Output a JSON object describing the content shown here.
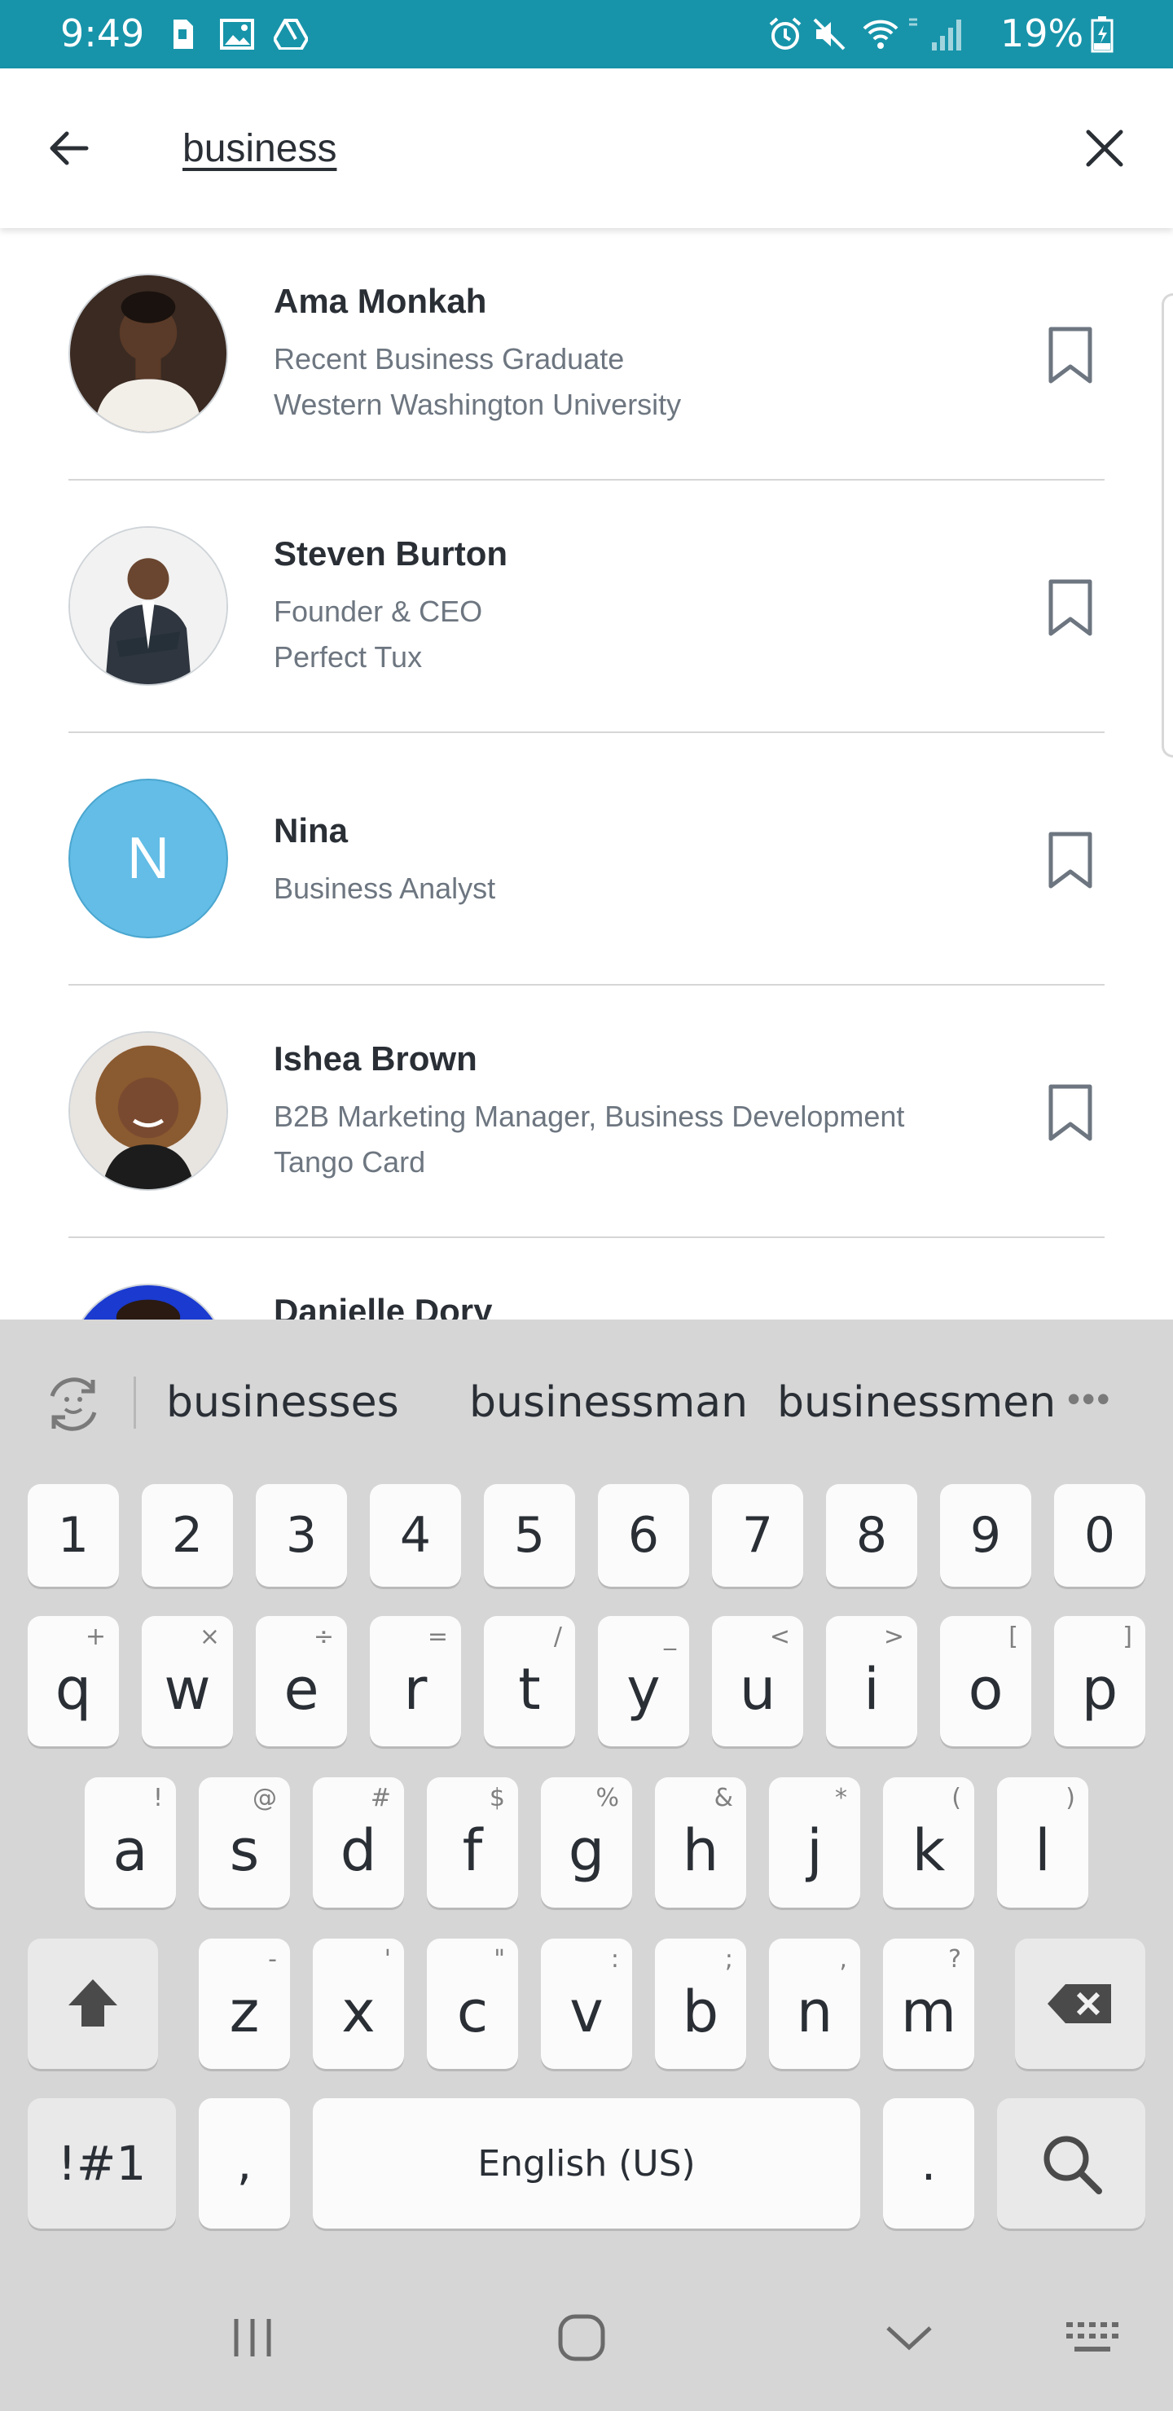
{
  "status_bar": {
    "time": "9:49",
    "battery": "19%",
    "color": "#1794aa",
    "icons": [
      "sim-icon",
      "gallery-icon",
      "drive-icon",
      "alarm-icon",
      "mute-icon",
      "wifi-icon",
      "signal-icon",
      "battery-charging-icon"
    ]
  },
  "search": {
    "query": "business",
    "back_icon": "arrow-left-icon",
    "clear_icon": "close-icon"
  },
  "results": [
    {
      "name": "Ama Monkah",
      "line1": "Recent Business Graduate",
      "line2": "Western Washington University",
      "avatar": "photo",
      "bookmark_icon": "bookmark-icon"
    },
    {
      "name": "Steven Burton",
      "line1": "Founder & CEO",
      "line2": "Perfect Tux",
      "avatar": "photo",
      "bookmark_icon": "bookmark-icon"
    },
    {
      "name": "Nina",
      "line1": "Business Analyst",
      "line2": "",
      "avatar": "initial",
      "initial": "N",
      "avatar_color": "#63bde6",
      "bookmark_icon": "bookmark-icon"
    },
    {
      "name": "Ishea Brown",
      "line1": "B2B Marketing Manager, Business Development",
      "line2": "Tango Card",
      "avatar": "photo",
      "bookmark_icon": "bookmark-icon"
    },
    {
      "name": "Danielle Dory",
      "line1": "",
      "line2": "",
      "avatar": "photo"
    }
  ],
  "keyboard": {
    "suggestions": [
      "businesses",
      "businessman",
      "businessmen"
    ],
    "more": "•••",
    "number_row": [
      "1",
      "2",
      "3",
      "4",
      "5",
      "6",
      "7",
      "8",
      "9",
      "0"
    ],
    "row1": [
      {
        "key": "q",
        "hint": "+"
      },
      {
        "key": "w",
        "hint": "×"
      },
      {
        "key": "e",
        "hint": "÷"
      },
      {
        "key": "r",
        "hint": "="
      },
      {
        "key": "t",
        "hint": "/"
      },
      {
        "key": "y",
        "hint": "_"
      },
      {
        "key": "u",
        "hint": "<"
      },
      {
        "key": "i",
        "hint": ">"
      },
      {
        "key": "o",
        "hint": "["
      },
      {
        "key": "p",
        "hint": "]"
      }
    ],
    "row2": [
      {
        "key": "a",
        "hint": "!"
      },
      {
        "key": "s",
        "hint": "@"
      },
      {
        "key": "d",
        "hint": "#"
      },
      {
        "key": "f",
        "hint": "$"
      },
      {
        "key": "g",
        "hint": "%"
      },
      {
        "key": "h",
        "hint": "&"
      },
      {
        "key": "j",
        "hint": "*"
      },
      {
        "key": "k",
        "hint": "("
      },
      {
        "key": "l",
        "hint": ")"
      }
    ],
    "row3": [
      {
        "key": "z",
        "hint": "-"
      },
      {
        "key": "x",
        "hint": "'"
      },
      {
        "key": "c",
        "hint": "\""
      },
      {
        "key": "v",
        "hint": ":"
      },
      {
        "key": "b",
        "hint": ";"
      },
      {
        "key": "n",
        "hint": ","
      },
      {
        "key": "m",
        "hint": "?"
      }
    ],
    "symbols_key": "!#1",
    "comma_key": ",",
    "space_label": "English (US)",
    "period_key": ".",
    "shift_icon": "shift-icon",
    "backspace_icon": "backspace-icon",
    "search_icon": "search-icon"
  },
  "navbar": {
    "icons": [
      "recent-apps-icon",
      "home-icon",
      "hide-keyboard-icon",
      "keyboard-icon"
    ]
  }
}
